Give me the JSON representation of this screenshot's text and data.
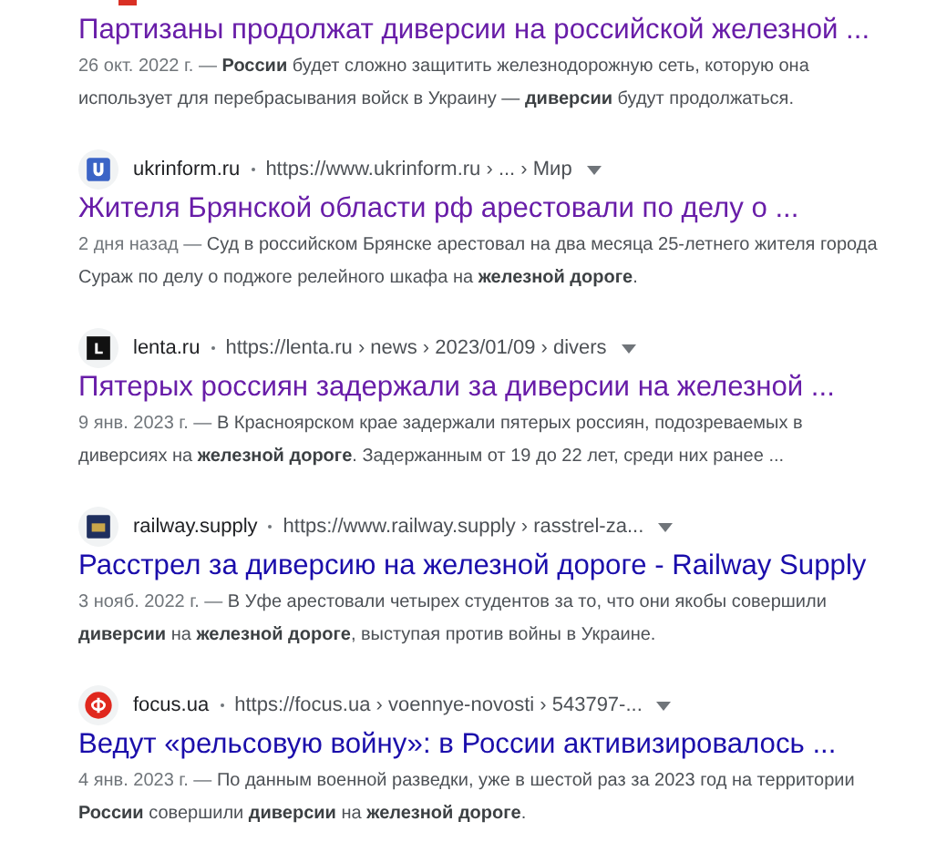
{
  "results": [
    {
      "visited": true,
      "title": "Партизаны продолжат диверсии на российской железной ...",
      "date": "26 окт. 2022 г. —",
      "snippet": "**России** будет сложно защитить железнодорожную сеть, которую она использует для перебрасывания войск в Украину — **диверсии** будут продолжаться."
    },
    {
      "visited": true,
      "site": "ukrinform.ru",
      "url": "https://www.ukrinform.ru › ... › Мир",
      "kind": "ukrinform",
      "title": "Жителя Брянской области рф арестовали по делу о ...",
      "date": "2 дня назад —",
      "snippet": "Суд в российском Брянске арестовал на два месяца 25-летнего жителя города Сураж по делу о поджоге релейного шкафа на **железной дороге**."
    },
    {
      "visited": true,
      "site": "lenta.ru",
      "url": "https://lenta.ru › news › 2023/01/09 › divers",
      "kind": "lenta",
      "title": "Пятерых россиян задержали за диверсии на железной ...",
      "date": "9 янв. 2023 г. —",
      "snippet": "В Красноярском крае задержали пятерых россиян, подозреваемых в диверсиях на **железной дороге**. Задержанным от 19 до 22 лет, среди них ранее ..."
    },
    {
      "visited": false,
      "site": "railway.supply",
      "url": "https://www.railway.supply › rasstrel-za...",
      "kind": "railway",
      "title": "Расстрел за диверсию на железной дороге - Railway Supply",
      "date": "3 нояб. 2022 г. —",
      "snippet": "В Уфе арестовали четырех студентов за то, что они якобы совершили **диверсии** на **железной дороге**, выступая против войны в Украине."
    },
    {
      "visited": false,
      "site": "focus.ua",
      "url": "https://focus.ua › voennye-novosti › 543797-...",
      "kind": "focus",
      "title": "Ведут «рельсовую войну»: в России активизировалось ...",
      "date": "4 янв. 2023 г. —",
      "snippet": "По данным военной разведки, уже в шестой раз за 2023 год на территории **России** совершили **диверсии** на **железной дороге**."
    }
  ]
}
